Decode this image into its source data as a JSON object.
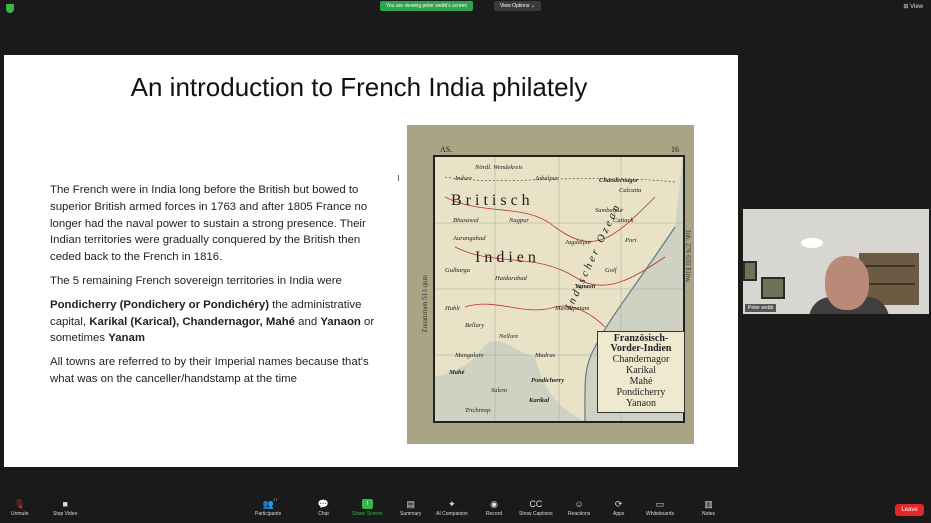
{
  "top_bar": {
    "viewing_text": "You are viewing peter webb's screen",
    "view_options": "View Options",
    "view_button": "View"
  },
  "slide": {
    "title": "An introduction to French India philately",
    "paragraph1": "The French were in India long before the British but bowed to superior British armed forces in 1763 and after 1805 France no longer had the naval power to sustain a strong presence. Their Indian territories were gradually conquered by the British then ceded back to the French in 1816.",
    "paragraph2": "The 5 remaining French sovereign territories in India were",
    "p3_b1": "Pondicherry (Pondichery or Pondichéry)",
    "p3_t1": " the administrative capital, ",
    "p3_b2": "Karikal (Karical), Chandernagor, Mahé",
    "p3_t2": " and ",
    "p3_b3": "Yanaon",
    "p3_t3": " or sometimes ",
    "p3_b4": "Yanam",
    "paragraph4": "All towns are referred to by their Imperial names because that's what was on the canceller/handstamp at the time"
  },
  "map": {
    "code": "AS.",
    "number": "16",
    "side_left": "Zusammen 513 qkm",
    "side_right": "Inh. 276 650 Einw.",
    "labels": [
      "Nördl. Wendekreis",
      "Jabalpur",
      "Indore",
      "Chandernagor",
      "Calcutta",
      "Britisch",
      "Bhusawal",
      "Nagpur",
      "Sambalpur",
      "Cuttack",
      "Aurangabad",
      "Jagdalpur",
      "Puri",
      "Indien",
      "Gulbarga",
      "Haidarabad",
      "Golf",
      "Yanaon",
      "Hubli",
      "Masulipatam",
      "Bellary",
      "Nellore",
      "Madras",
      "Mangalore",
      "Pondicherry",
      "Mahé",
      "Salem",
      "Karikal",
      "Trichinop."
    ],
    "legend": {
      "title": "Französisch-",
      "subtitle_1": "Vorder-",
      "subtitle_2": "Indien",
      "towns": [
        "Chandernagor",
        "Karikal",
        "Mahé",
        "Pondicherry",
        "Yanaon"
      ]
    },
    "ocean_label": "Indischer Ozean"
  },
  "video": {
    "participant_name": "Peter webb"
  },
  "controls": {
    "unmute": "Unmute",
    "stop_video": "Stop Video",
    "participants": "Participants",
    "participants_count": "17",
    "chat": "Chat",
    "share_screen": "Share Screen",
    "summary": "Summary",
    "ai_companion": "AI Companion",
    "record": "Record",
    "show_captions": "Show Captions",
    "reactions": "Reactions",
    "apps": "Apps",
    "whiteboards": "Whiteboards",
    "notes": "Notes",
    "leave": "Leave"
  },
  "colors": {
    "share_green": "#39b54a",
    "leave_red": "#e02828",
    "background": "#1a1a1a"
  }
}
